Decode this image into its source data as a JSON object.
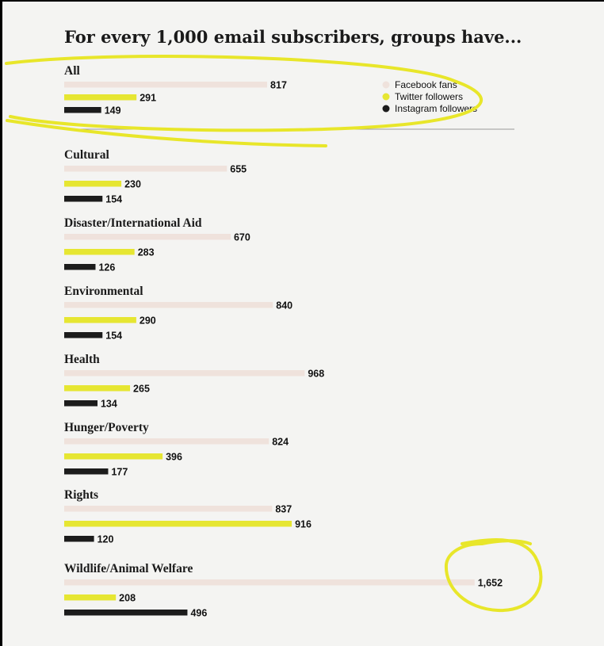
{
  "chart_data": {
    "type": "bar",
    "title": "For every 1,000 email subscribers, groups have...",
    "orientation": "horizontal",
    "series": [
      {
        "name": "Facebook fans",
        "color": "#efe2dc"
      },
      {
        "name": "Twitter followers",
        "color": "#e6e632"
      },
      {
        "name": "Instagram followers",
        "color": "#1c1c1c"
      }
    ],
    "groups": [
      {
        "category": "All",
        "values": [
          817,
          291,
          149
        ],
        "labels": [
          "817",
          "291",
          "149"
        ]
      },
      {
        "category": "Cultural",
        "values": [
          655,
          230,
          154
        ],
        "labels": [
          "655",
          "230",
          "154"
        ]
      },
      {
        "category": "Disaster/International Aid",
        "values": [
          670,
          283,
          126
        ],
        "labels": [
          "670",
          "283",
          "126"
        ]
      },
      {
        "category": "Environmental",
        "values": [
          840,
          290,
          154
        ],
        "labels": [
          "840",
          "290",
          "154"
        ]
      },
      {
        "category": "Health",
        "values": [
          968,
          265,
          134
        ],
        "labels": [
          "968",
          "265",
          "134"
        ]
      },
      {
        "category": "Hunger/Poverty",
        "values": [
          824,
          396,
          177
        ],
        "labels": [
          "824",
          "396",
          "177"
        ]
      },
      {
        "category": "Rights",
        "values": [
          837,
          916,
          120
        ],
        "labels": [
          "837",
          "916",
          "120"
        ]
      },
      {
        "category": "Wildlife/Animal Welfare",
        "values": [
          1652,
          208,
          496
        ],
        "labels": [
          "1,652",
          "208",
          "496"
        ]
      }
    ],
    "legend_position": "top-right",
    "annotations": [
      "yellow hand-drawn circle around the All group",
      "yellow hand-drawn circle around the 1,652 label"
    ]
  }
}
